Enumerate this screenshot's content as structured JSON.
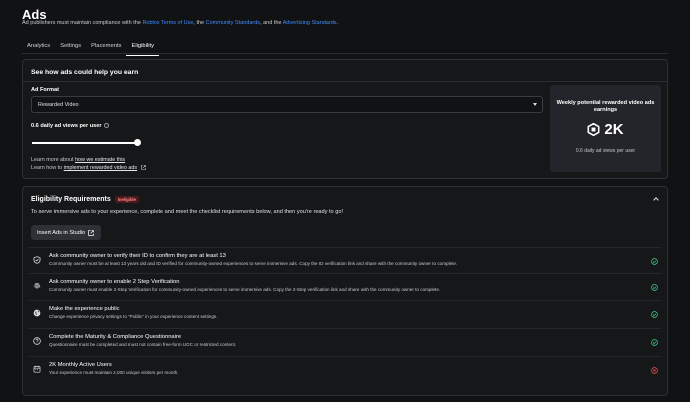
{
  "header": {
    "title": "Ads",
    "subtitle_prefix": "Ad publishers must maintain compliance with the ",
    "link_tos": "Roblox Terms of Use",
    "sep1": ", the ",
    "link_community": "Community Standards",
    "sep2": ", and the ",
    "link_ads": "Advertising Standards",
    "end": "."
  },
  "tabs": [
    {
      "label": "Analytics",
      "active": false
    },
    {
      "label": "Settings",
      "active": false
    },
    {
      "label": "Placements",
      "active": false
    },
    {
      "label": "Eligibility",
      "active": true
    }
  ],
  "estimator": {
    "title": "See how ads could help you earn",
    "ad_format_label": "Ad Format",
    "ad_format_value": "Rewarded Video",
    "views_label": "0.6 daily ad views per user",
    "slider_value": 0.6,
    "learn1_prefix": "Learn more about ",
    "learn1_link": "how we estimate this",
    "learn2_prefix": "Learn how to ",
    "learn2_link": "implement rewarded video ads",
    "earnings_title": "Weekly potential rewarded video ads earnings",
    "earnings_value": "2K",
    "earnings_sub": "0.6 daily ad views per user"
  },
  "eligibility": {
    "title": "Eligibility Requirements",
    "badge": "Ineligible",
    "description": "To serve immersive ads to your experience, complete and meet the checklist requirements below, and then you're ready to go!",
    "button": "Insert Ads in Studio",
    "requirements": [
      {
        "icon": "shield-check-icon",
        "title": "Ask community owner to verify their ID to confirm they are at least 13",
        "desc": "Community owner must be at least 13 years old and ID verified for community-owned experiences to serve immersive ads. Copy the ID verification link and share with the community owner to complete.",
        "status": "complete"
      },
      {
        "icon": "fingerprint-icon",
        "title": "Ask community owner to enable 2 Step Verification",
        "desc": "Community owner must enable 2-Step Verification for community-owned experiences to serve immersive ads. Copy the 2-Step verification link and share with the community owner to complete.",
        "status": "complete"
      },
      {
        "icon": "globe-icon",
        "title": "Make the experience public",
        "desc": "Change experience privacy settings to \"Public\" in your experience content settings.",
        "status": "complete"
      },
      {
        "icon": "question-icon",
        "title": "Complete the Maturity & Compliance Questionnaire",
        "desc": "Questionnaire must be completed and must not contain free-form UGC or restricted content.",
        "status": "complete"
      },
      {
        "icon": "calendar-icon",
        "title": "2K Monthly Active Users",
        "desc": "Your experience must maintain 2,000 unique visitors per month.",
        "status": "failed"
      }
    ]
  },
  "colors": {
    "link": "#3d8bff",
    "success": "#3fbf7f",
    "error": "#e5484d",
    "badge_bg": "#4a1a1d"
  }
}
